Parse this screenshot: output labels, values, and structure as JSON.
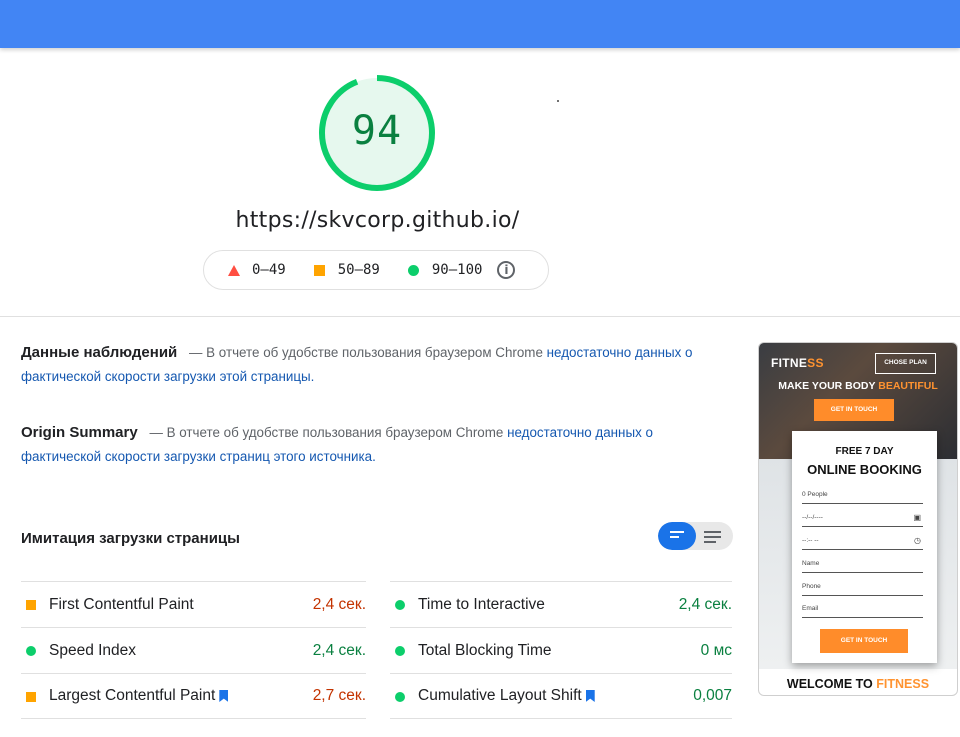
{
  "colors": {
    "topbar": "#4285f4",
    "pass": "#0cce6b",
    "pass_text": "#0a8040",
    "average": "#ffa400",
    "average_text": "#c33300",
    "fail": "#ff4e42",
    "link": "#1558b0",
    "accent_orange": "#ff8c2a"
  },
  "summary": {
    "score": "94",
    "score_fraction": 0.94,
    "url": "https://skvcorp.github.io/"
  },
  "legend": {
    "fail_label": "0–49",
    "average_label": "50–89",
    "pass_label": "90–100",
    "info_icon": "info-icon",
    "info_glyph": "i"
  },
  "field_data": {
    "title": "Данные наблюдений",
    "dash": "—",
    "text": "В отчете об удобстве пользования браузером Chrome",
    "link": "недостаточно данных о фактической скорости загрузки этой страницы."
  },
  "origin_summary": {
    "title": "Origin Summary",
    "dash": "—",
    "text": "В отчете об удобстве пользования браузером Chrome",
    "link": "недостаточно данных о фактической скорости загрузки страниц этого источника."
  },
  "lab": {
    "title": "Имитация загрузки страницы",
    "view_toggle": [
      "compact-view-icon",
      "detailed-view-icon"
    ],
    "metrics_left": [
      {
        "name": "First Contentful Paint",
        "value": "2,4 сек.",
        "status": "average",
        "bookmark": false
      },
      {
        "name": "Speed Index",
        "value": "2,4 сек.",
        "status": "pass",
        "bookmark": false
      },
      {
        "name": "Largest Contentful Paint",
        "value": "2,7 сек.",
        "status": "average",
        "bookmark": true
      }
    ],
    "metrics_right": [
      {
        "name": "Time to Interactive",
        "value": "2,4 сек.",
        "status": "pass",
        "bookmark": false
      },
      {
        "name": "Total Blocking Time",
        "value": "0 мс",
        "status": "pass",
        "bookmark": false
      },
      {
        "name": "Cumulative Layout Shift",
        "value": "0,007",
        "status": "pass",
        "bookmark": true
      }
    ]
  },
  "thumbnail": {
    "brand_main": "FITNE",
    "brand_accent": "SS",
    "chose_plan": "CHOSE PLAN",
    "headline_main": "MAKE YOUR BODY",
    "headline_accent": "BEAUTIFUL",
    "cta_top": "GET IN TOUCH",
    "card_kicker": "FREE 7 DAY",
    "card_title": "ONLINE BOOKING",
    "fields": [
      "0 People",
      "--/--/----",
      "--:-- --",
      "Name",
      "Phone",
      "Email"
    ],
    "field_icons": [
      "",
      "calendar-icon",
      "clock-icon",
      "",
      "",
      ""
    ],
    "cta_card": "GET IN TOUCH",
    "welcome_main": "WELCOME TO",
    "welcome_accent": "FITNESS"
  }
}
